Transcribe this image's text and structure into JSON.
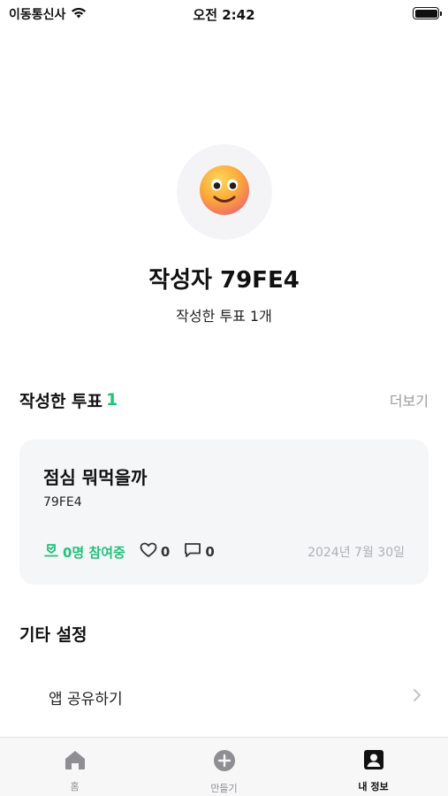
{
  "status_bar": {
    "carrier": "이동통신사",
    "time": "오전 2:42",
    "battery_level": 1.0
  },
  "profile": {
    "name": "작성자 79FE4",
    "summary": "작성한 투표 1개",
    "avatar_icon": "smiling-face-emoji"
  },
  "polls_section": {
    "title": "작성한 투표",
    "count": "1",
    "more_label": "더보기"
  },
  "poll_card": {
    "title": "점심 뭐먹을까",
    "author": "79FE4",
    "participants": "0명 참여중",
    "likes": "0",
    "comments": "0",
    "date": "2024년 7월 30일"
  },
  "settings": {
    "title": "기타 설정",
    "items": [
      {
        "label": "앱 공유하기"
      }
    ]
  },
  "tab_bar": {
    "tabs": [
      {
        "label": "홈",
        "icon": "home-icon",
        "active": false
      },
      {
        "label": "만들기",
        "icon": "plus-circle-icon",
        "active": false
      },
      {
        "label": "내 정보",
        "icon": "person-square-icon",
        "active": true
      }
    ]
  },
  "colors": {
    "accent": "#22c27a",
    "card_bg": "#f5f6f8",
    "muted": "#9a9a9a"
  }
}
